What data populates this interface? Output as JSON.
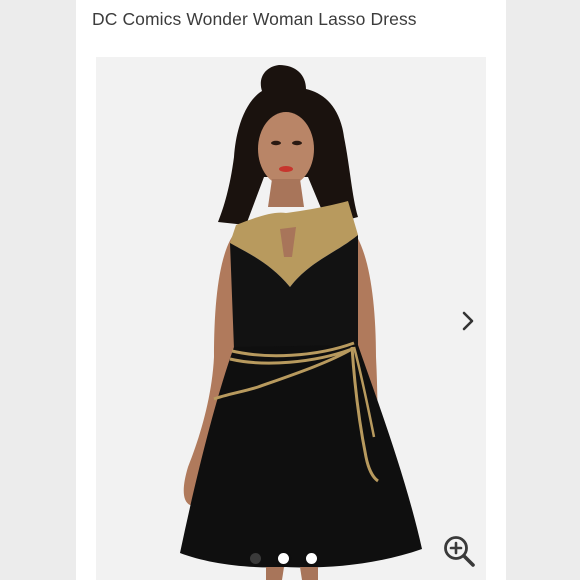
{
  "listing": {
    "title": "DC Comics Wonder Woman Lasso Dress"
  },
  "gallery": {
    "image_count": 3,
    "active_index": 0,
    "next_icon": "chevron-right-icon",
    "zoom_icon": "zoom-in-icon"
  },
  "colors": {
    "dress": "#111111",
    "gold_trim": "#b89a5e",
    "background": "#f2f2f2"
  }
}
